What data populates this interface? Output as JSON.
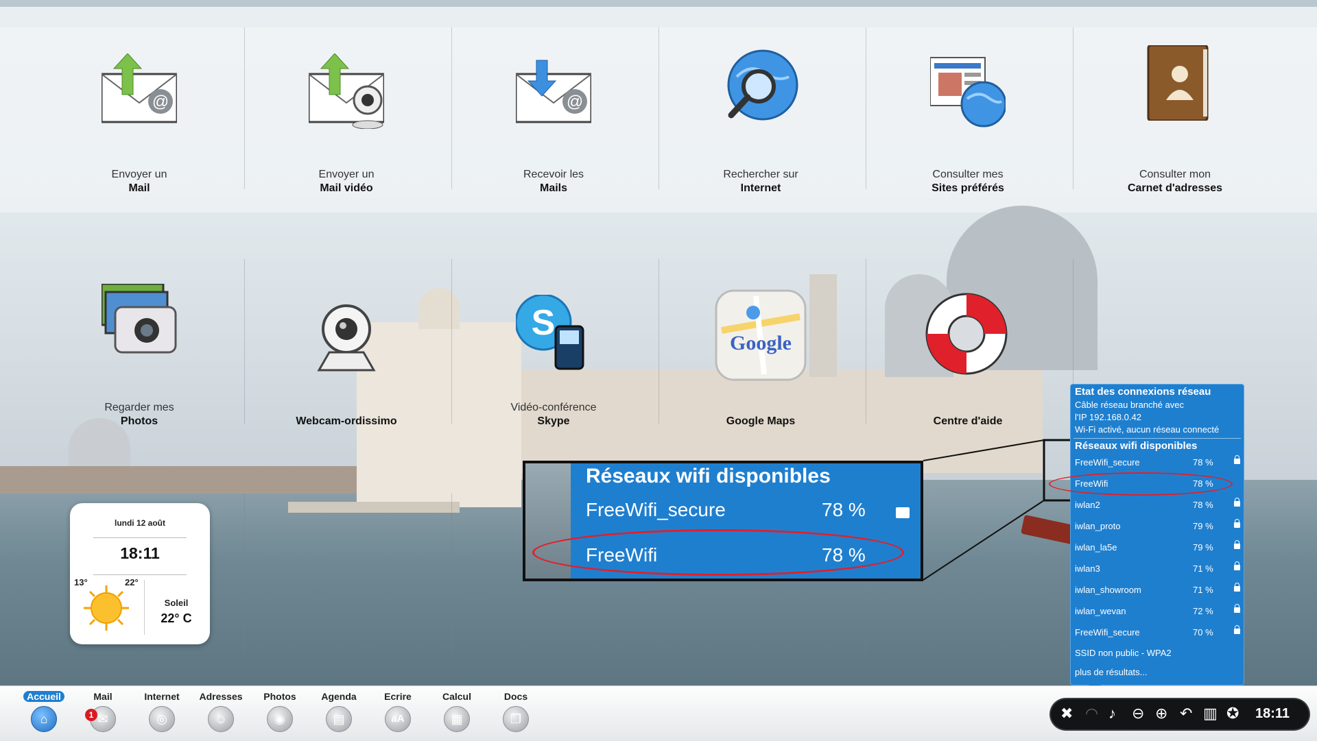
{
  "tiles": [
    {
      "line1": "Envoyer un",
      "line2": "Mail",
      "icon": "send-mail-icon"
    },
    {
      "line1": "Envoyer un",
      "line2": "Mail vidéo",
      "icon": "video-mail-icon"
    },
    {
      "line1": "Recevoir les",
      "line2": "Mails",
      "icon": "receive-mail-icon"
    },
    {
      "line1": "Rechercher sur",
      "line2": "Internet",
      "icon": "search-globe-icon"
    },
    {
      "line1": "Consulter mes",
      "line2": "Sites préférés",
      "icon": "favorite-sites-icon"
    },
    {
      "line1": "Consulter mon",
      "line2": "Carnet d'adresses",
      "icon": "address-book-icon"
    },
    {
      "line1": "Regarder mes",
      "line2": "Photos",
      "icon": "camera-icon"
    },
    {
      "line1": "",
      "line2": "Webcam-ordissimo",
      "icon": "webcam-icon"
    },
    {
      "line1": "Vidéo-conférence",
      "line2": "Skype",
      "icon": "skype-icon"
    },
    {
      "line1": "",
      "line2": "Google Maps",
      "icon": "google-maps-icon"
    },
    {
      "line1": "",
      "line2": "Centre d'aide",
      "icon": "lifebuoy-icon"
    }
  ],
  "weather": {
    "date": "lundi 12 août",
    "time": "18:11",
    "low": "13°",
    "high": "22°",
    "condition": "Soleil",
    "temp": "22° C",
    "icon": "sun-icon"
  },
  "taskbar": {
    "items": [
      {
        "label": "Accueil",
        "icon": "home-icon",
        "active": true
      },
      {
        "label": "Mail",
        "icon": "mail-icon",
        "badge": "1"
      },
      {
        "label": "Internet",
        "icon": "globe-icon"
      },
      {
        "label": "Adresses",
        "icon": "contacts-icon"
      },
      {
        "label": "Photos",
        "icon": "camera-icon"
      },
      {
        "label": "Agenda",
        "icon": "agenda-icon"
      },
      {
        "label": "Ecrire",
        "icon": "text-icon",
        "glyph": "aA"
      },
      {
        "label": "Calcul",
        "icon": "calculator-icon"
      },
      {
        "label": "Docs",
        "icon": "docs-icon"
      }
    ],
    "clock": "18:11"
  },
  "network_panel": {
    "title": "Etat des connexions réseau",
    "status1": "Câble réseau branché avec",
    "status2": "l'IP 192.168.0.42",
    "status3": "Wi-Fi activé, aucun réseau connecté",
    "wifi_title": "Réseaux wifi disponibles",
    "networks": [
      {
        "ssid": "FreeWifi_secure",
        "signal": "78 %",
        "locked": true
      },
      {
        "ssid": "FreeWifi",
        "signal": "78 %",
        "locked": false
      },
      {
        "ssid": "iwlan2",
        "signal": "78 %",
        "locked": true
      },
      {
        "ssid": "iwlan_proto",
        "signal": "79 %",
        "locked": true
      },
      {
        "ssid": "iwlan_la5e",
        "signal": "79 %",
        "locked": true
      },
      {
        "ssid": "iwlan3",
        "signal": "71 %",
        "locked": true
      },
      {
        "ssid": "iwlan_showroom",
        "signal": "71 %",
        "locked": true
      },
      {
        "ssid": "iwlan_wevan",
        "signal": "72 %",
        "locked": true
      },
      {
        "ssid": "FreeWifi_secure",
        "signal": "70 %",
        "locked": true
      }
    ],
    "ssid_hidden": "SSID non public - WPA2",
    "more": "plus de résultats..."
  },
  "zoom_callout": {
    "title": "Réseaux wifi disponibles",
    "row1_ssid": "FreeWifi_secure",
    "row1_signal": "78 %",
    "row2_ssid": "FreeWifi",
    "row2_signal": "78 %"
  },
  "colors": {
    "accent": "#1f7fcf",
    "highlight": "#e0202a"
  }
}
